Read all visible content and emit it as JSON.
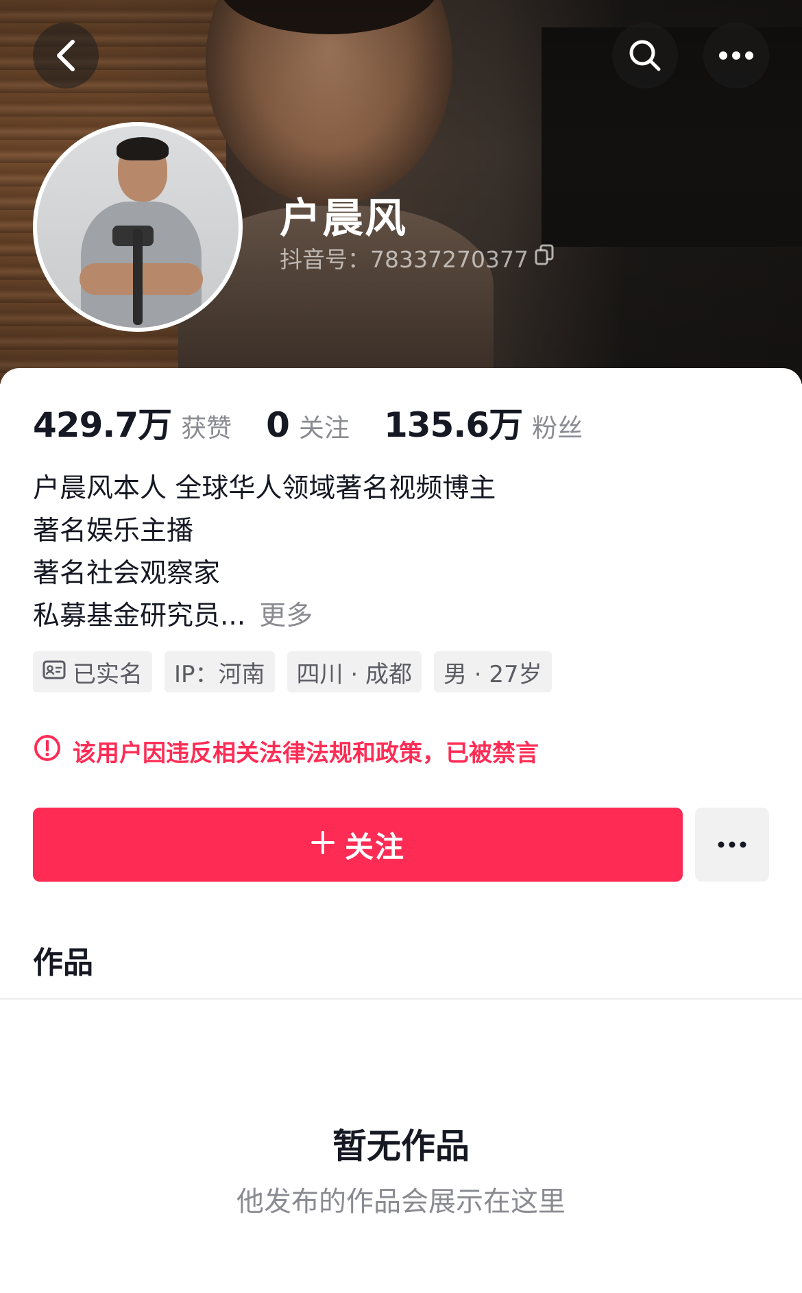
{
  "profile": {
    "name": "户晨风",
    "douyin_id": "抖音号：78337270377"
  },
  "icons": {
    "back": "chevron-left-icon",
    "search": "search-icon",
    "more": "more-horizontal-icon",
    "copy": "copy-icon",
    "id_card": "id-card-icon",
    "alert": "alert-circle-icon",
    "plus": "plus-icon"
  },
  "stats": [
    {
      "value": "429.7万",
      "label": "获赞"
    },
    {
      "value": "0",
      "label": "关注"
    },
    {
      "value": "135.6万",
      "label": "粉丝"
    }
  ],
  "bio": {
    "lines": [
      "户晨风本人  全球华人领域著名视频博主",
      "著名娱乐主播",
      "著名社会观察家",
      "私募基金研究员..."
    ],
    "more_label": "更多"
  },
  "tags": [
    {
      "label": "已实名",
      "icon": "id-card-icon"
    },
    {
      "label": "IP：河南"
    },
    {
      "label": "四川 · 成都"
    },
    {
      "label": "男 · 27岁"
    }
  ],
  "ban_notice": "该用户因违反相关法律法规和政策，已被禁言",
  "follow_button": {
    "label": "关注"
  },
  "works_tab": "作品",
  "empty_state": {
    "title": "暂无作品",
    "subtitle": "他发布的作品会展示在这里"
  },
  "colors": {
    "accent": "#fe2c55",
    "text_primary": "#161823",
    "text_secondary": "#8a8b91",
    "tag_bg": "#f1f1f2"
  }
}
